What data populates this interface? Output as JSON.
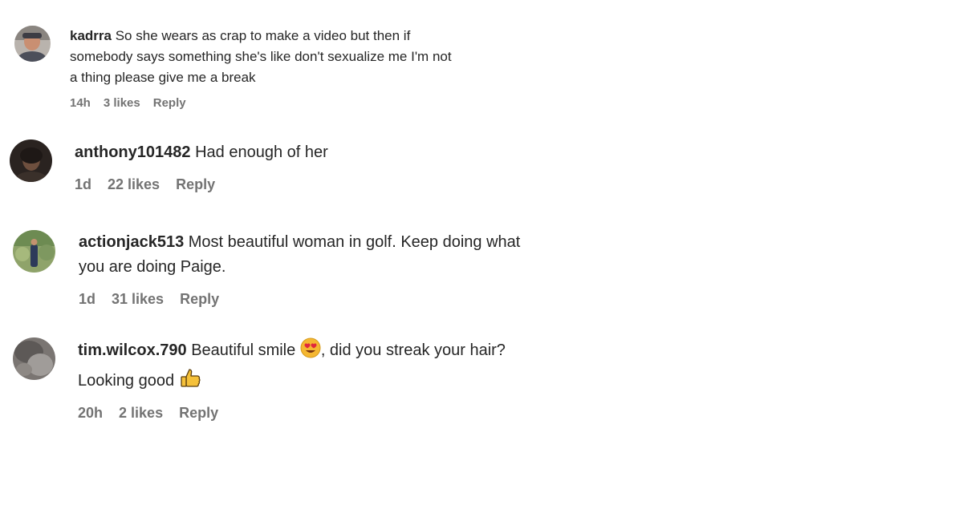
{
  "comments": [
    {
      "username": "kadrra",
      "text": "So she wears as crap to make a video but then if somebody says something she's like don't sexualize me I'm not a thing please give me a break",
      "text_lines": [
        "So she wears as crap to make a video but then if",
        "somebody says something she's like don't sexualize me I'm not",
        "a thing please give me a break"
      ],
      "time": "14h",
      "likes": "3 likes",
      "reply_label": "Reply",
      "avatar_icon": "user-avatar-photo"
    },
    {
      "username": "anthony101482",
      "text": "Had enough of her",
      "time": "1d",
      "likes": "22 likes",
      "reply_label": "Reply",
      "avatar_icon": "user-avatar-photo"
    },
    {
      "username": "actionjack513",
      "text_line1": "Most beautiful woman in golf. Keep doing what",
      "text_line2": "you are doing Paige.",
      "time": "1d",
      "likes": "31 likes",
      "reply_label": "Reply",
      "avatar_icon": "user-avatar-photo"
    },
    {
      "username": "tim.wilcox.790",
      "text_part1": "Beautiful smile",
      "emoji1": "heart-eyes-emoji",
      "text_part2": ", did you streak your hair?",
      "text_part3": "Looking good",
      "emoji2": "thumbs-up-emoji",
      "time": "20h",
      "likes": "2 likes",
      "reply_label": "Reply",
      "avatar_icon": "user-avatar-photo"
    }
  ],
  "colors": {
    "text": "#262626",
    "meta": "#737373",
    "background": "#ffffff"
  }
}
